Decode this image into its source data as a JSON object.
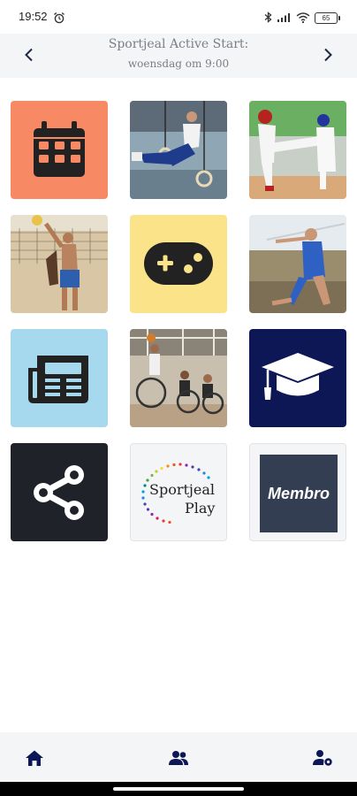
{
  "status_bar": {
    "time": "19:52",
    "battery_level": "65",
    "icons": [
      "alarm-icon",
      "bluetooth-icon",
      "signal-icon",
      "wifi-icon",
      "battery-icon"
    ]
  },
  "header": {
    "title": "Sportjeal Active Start:",
    "subtitle": "woensdag om 9:00",
    "prev_icon": "chevron-left-icon",
    "next_icon": "chevron-right-icon"
  },
  "tiles": [
    {
      "name": "calendar",
      "icon": "calendar-icon",
      "bg": "#f78a64"
    },
    {
      "name": "gymnastics-rings",
      "kind": "photo"
    },
    {
      "name": "taekwondo",
      "kind": "photo"
    },
    {
      "name": "beach-volleyball",
      "kind": "photo"
    },
    {
      "name": "games",
      "icon": "gamepad-icon",
      "bg": "#fbe38a"
    },
    {
      "name": "javelin",
      "kind": "photo"
    },
    {
      "name": "news",
      "icon": "newspaper-icon",
      "bg": "#a6d8ee"
    },
    {
      "name": "wheelchair-basketball",
      "kind": "photo"
    },
    {
      "name": "education",
      "icon": "graduation-cap-icon",
      "bg": "#0e1756"
    },
    {
      "name": "share",
      "icon": "share-icon",
      "bg": "#1f2228"
    },
    {
      "name": "sportjeal-play",
      "logo_line1": "Sportjeal",
      "logo_line2": "Play"
    },
    {
      "name": "membro",
      "logo_text": "Membro",
      "bg": "#333e52"
    }
  ],
  "bottom_nav": {
    "items": [
      "home-icon",
      "groups-icon",
      "account-settings-icon"
    ],
    "accent": "#0e1756"
  }
}
